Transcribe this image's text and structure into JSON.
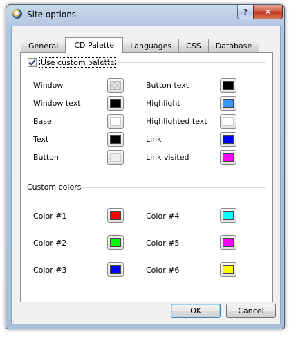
{
  "window": {
    "title": "Site options",
    "help_label": "?",
    "close_label": "✕"
  },
  "tabs": [
    {
      "label": "General"
    },
    {
      "label": "CD Palette"
    },
    {
      "label": "Languages"
    },
    {
      "label": "CSS"
    },
    {
      "label": "Database"
    }
  ],
  "active_tab": "CD Palette",
  "use_custom_palette": {
    "label": "Use custom palette",
    "checked": true
  },
  "palette": {
    "left": [
      {
        "label": "Window",
        "color": "#dcdcdc"
      },
      {
        "label": "Window text",
        "color": "#000000"
      },
      {
        "label": "Base",
        "color": "#ffffff"
      },
      {
        "label": "Text",
        "color": "#000000"
      },
      {
        "label": "Button",
        "color": "#eeeeee"
      }
    ],
    "right": [
      {
        "label": "Button text",
        "color": "#000000"
      },
      {
        "label": "Highlight",
        "color": "#3399ff"
      },
      {
        "label": "Highlighted text",
        "color": "#ffffff"
      },
      {
        "label": "Link",
        "color": "#0000ff"
      },
      {
        "label": "Link visited",
        "color": "#ff00ff"
      }
    ]
  },
  "custom_colors": {
    "title": "Custom colors",
    "left": [
      {
        "label": "Color #1",
        "color": "#ff0000"
      },
      {
        "label": "Color #2",
        "color": "#00ff00"
      },
      {
        "label": "Color #3",
        "color": "#0000ff"
      }
    ],
    "right": [
      {
        "label": "Color #4",
        "color": "#00ffff"
      },
      {
        "label": "Color #5",
        "color": "#ff00ff"
      },
      {
        "label": "Color #6",
        "color": "#ffff00"
      }
    ]
  },
  "buttons": {
    "ok": "OK",
    "cancel": "Cancel"
  }
}
